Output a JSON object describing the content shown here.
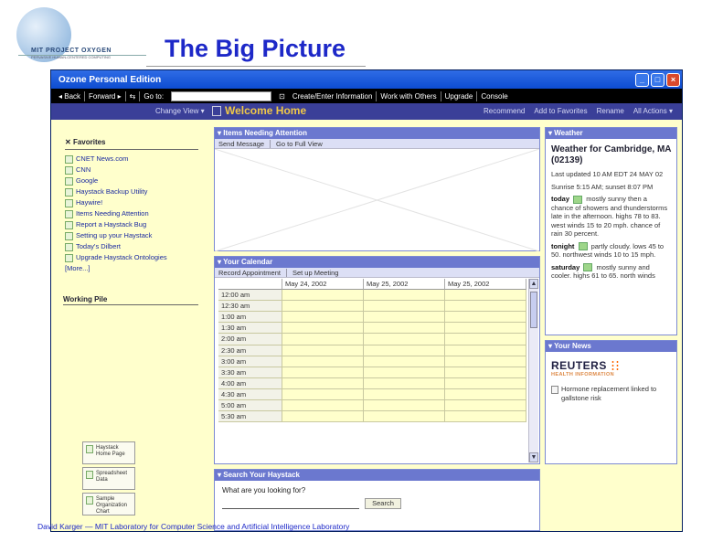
{
  "slide": {
    "title": "The Big Picture",
    "logo_text": "MIT PROJECT OXYGEN",
    "logo_sub": "PERVASIVE HUMAN-CENTERED COMPUTING",
    "footer": "David Karger — MIT Laboratory for Computer Science and Artificial Intelligence Laboratory"
  },
  "window": {
    "title": "Ozone Personal Edition",
    "buttons": [
      "_",
      "□",
      "×"
    ]
  },
  "menubar": {
    "back": "◂ Back",
    "forward": "Forward ▸",
    "goto": "Go to:",
    "goto_value": "",
    "items": [
      "Create/Enter Information",
      "Work with Others",
      "Upgrade",
      "Console"
    ]
  },
  "viewbar": {
    "change_view": "Change View ▾",
    "page_title": "Welcome Home",
    "actions": [
      "Recommend",
      "Add to Favorites",
      "Rename",
      "All Actions ▾"
    ]
  },
  "favorites": {
    "title": "Favorites",
    "items": [
      "CNET News.com",
      "CNN",
      "Google",
      "Haystack Backup Utility",
      "Haywire!",
      "Items Needing Attention",
      "Report a Haystack Bug",
      "Setting up your Haystack",
      "Today's Dilbert",
      "Upgrade Haystack Ontologies"
    ],
    "more": "[More...]"
  },
  "working_pile": {
    "title": "Working Pile",
    "items": [
      "Haystack Home Page",
      "Spreadsheet Data",
      "Sample Organization Chart"
    ]
  },
  "attention": {
    "title": "Items Needing Attention",
    "tools": [
      "Send Message",
      "Go to Full View"
    ]
  },
  "calendar": {
    "title": "Your Calendar",
    "tools": [
      "Record Appointment",
      "Set up Meeting"
    ],
    "dates": [
      "May 24, 2002",
      "May 25, 2002",
      "May 25, 2002"
    ],
    "times": [
      "12:00 am",
      "12:30 am",
      "1:00 am",
      "1:30 am",
      "2:00 am",
      "2:30 am",
      "3:00 am",
      "3:30 am",
      "4:00 am",
      "4:30 am",
      "5:00 am",
      "5:30 am"
    ]
  },
  "search": {
    "title": "Search Your Haystack",
    "question": "What are you looking for?",
    "button": "Search"
  },
  "weather": {
    "title": "Weather",
    "location": "Weather for Cambridge, MA (02139)",
    "updated": "Last updated 10 AM EDT 24 MAY 02",
    "sun": "Sunrise 5:15 AM; sunset 8:07 PM",
    "forecasts": [
      {
        "day": "today",
        "text": "mostly sunny then a chance of showers and thunderstorms late in the afternoon. highs 78 to 83. west winds 15 to 20 mph. chance of rain 30 percent."
      },
      {
        "day": "tonight",
        "text": "partly cloudy. lows 45 to 50. northwest winds 10 to 15 mph."
      },
      {
        "day": "saturday",
        "text": "mostly sunny and cooler. highs 61 to 65. north winds"
      }
    ]
  },
  "news": {
    "title": "Your News",
    "brand": "REUTERS",
    "brand_sub": "HEALTH INFORMATION",
    "item": "Hormone replacement linked to gallstone risk"
  }
}
